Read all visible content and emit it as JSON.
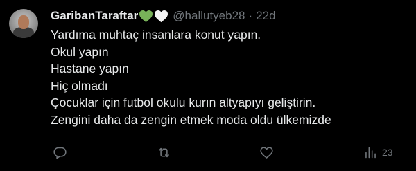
{
  "tweet": {
    "display_name": "GaribanTaraftar",
    "handle": "@hallutyeb28",
    "separator": "·",
    "time": "22d",
    "emojis": [
      "green-heart",
      "white-heart"
    ],
    "lines": [
      "Yardıma muhtaç insanlara konut yapın.",
      "Okul yapın",
      "Hastane yapın",
      "Hiç olmadı",
      "Çocuklar için futbol okulu kurın altyapıyı geliştirin.",
      "Zengini daha da zengin etmek moda oldu ülkemizde"
    ],
    "actions": {
      "reply_icon": "reply-icon",
      "retweet_icon": "retweet-icon",
      "like_icon": "heart-icon",
      "views_icon": "views-icon",
      "views_count": "23"
    }
  },
  "colors": {
    "background": "#000000",
    "text": "#e7e9ea",
    "muted": "#71767b",
    "green_heart": "#78b159",
    "white_heart": "#ffffff"
  }
}
